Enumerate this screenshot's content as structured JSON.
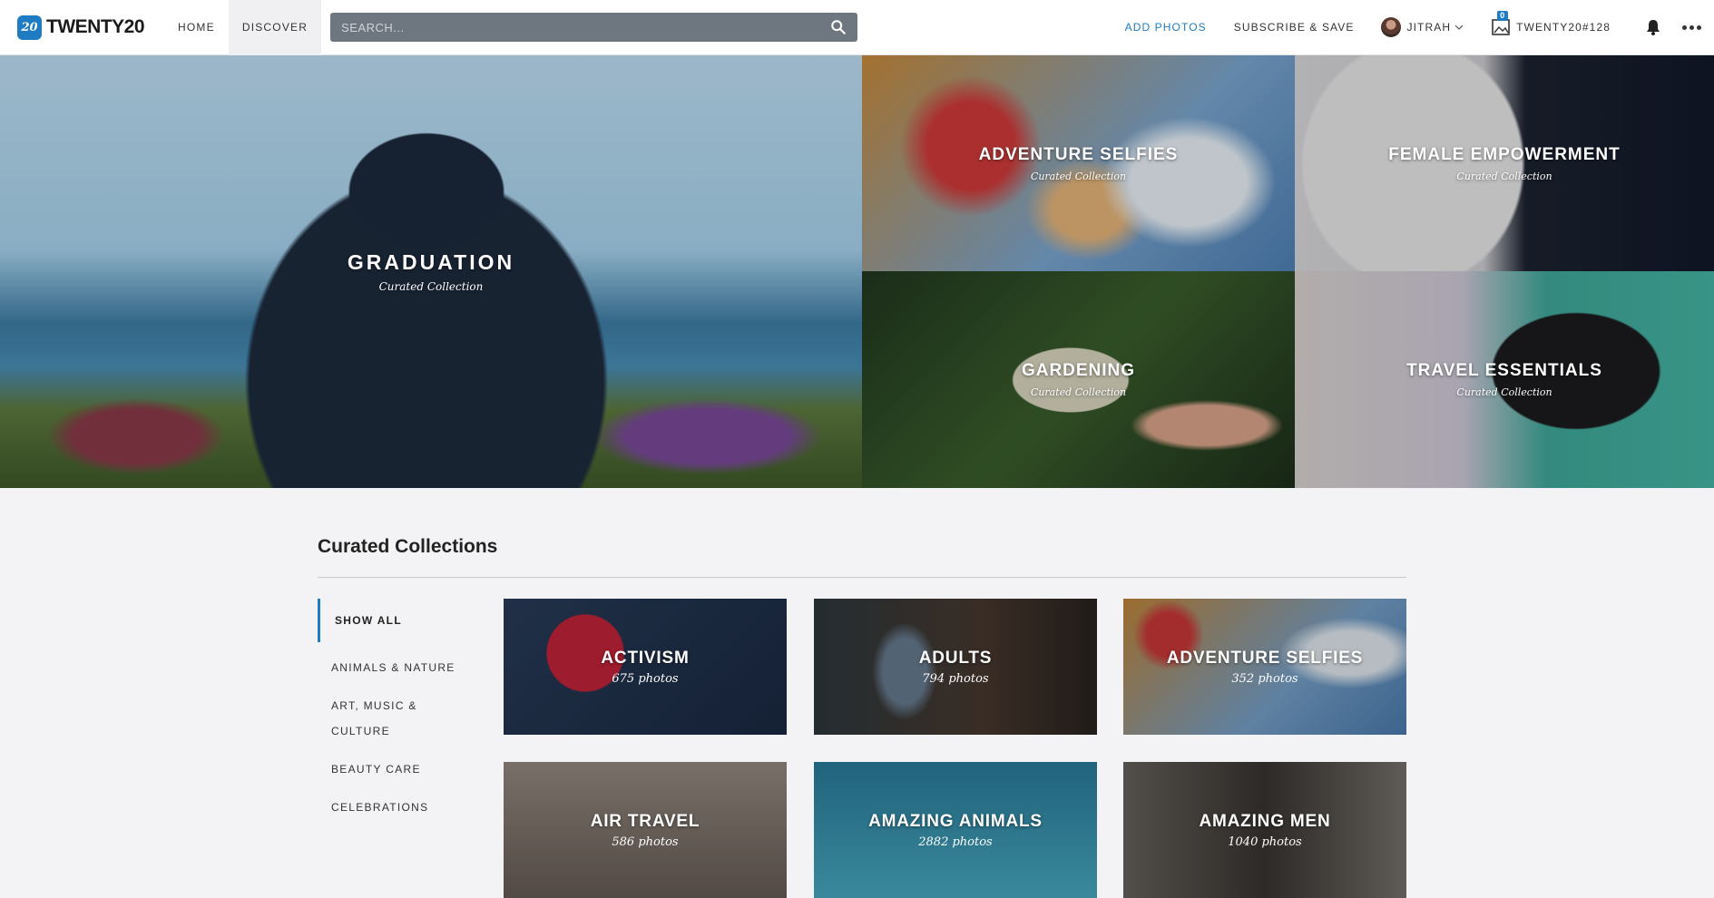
{
  "brand": {
    "name": "TWENTY20",
    "badge": "20"
  },
  "nav": {
    "home": "HOME",
    "discover": "DISCOVER"
  },
  "search": {
    "placeholder": "SEARCH..."
  },
  "right_nav": {
    "add_photos": "ADD PHOTOS",
    "subscribe": "SUBSCRIBE & SAVE",
    "user": "JITRAH",
    "lightbox": "TWENTY20#128",
    "lightbox_count": "0"
  },
  "hero": {
    "graduation": {
      "title": "GRADUATION",
      "subtitle": "Curated Collection"
    },
    "adventure": {
      "title": "ADVENTURE SELFIES",
      "subtitle": "Curated Collection"
    },
    "female": {
      "title": "FEMALE EMPOWERMENT",
      "subtitle": "Curated Collection"
    },
    "gardening": {
      "title": "GARDENING",
      "subtitle": "Curated Collection"
    },
    "travel": {
      "title": "TRAVEL ESSENTIALS",
      "subtitle": "Curated Collection"
    }
  },
  "collections": {
    "title": "Curated Collections",
    "categories": [
      "SHOW ALL",
      "ANIMALS & NATURE",
      "ART, MUSIC & CULTURE",
      "BEAUTY CARE",
      "CELEBRATIONS"
    ],
    "cards": [
      {
        "title": "ACTIVISM",
        "count": "675 photos"
      },
      {
        "title": "ADULTS",
        "count": "794 photos"
      },
      {
        "title": "ADVENTURE SELFIES",
        "count": "352 photos"
      },
      {
        "title": "AIR TRAVEL",
        "count": "586 photos"
      },
      {
        "title": "AMAZING ANIMALS",
        "count": "2882 photos"
      },
      {
        "title": "AMAZING MEN",
        "count": "1040 photos"
      }
    ]
  },
  "colors": {
    "accent": "#1f7cc2",
    "search_bg": "#6e7680",
    "page_bg": "#f3f3f5"
  }
}
